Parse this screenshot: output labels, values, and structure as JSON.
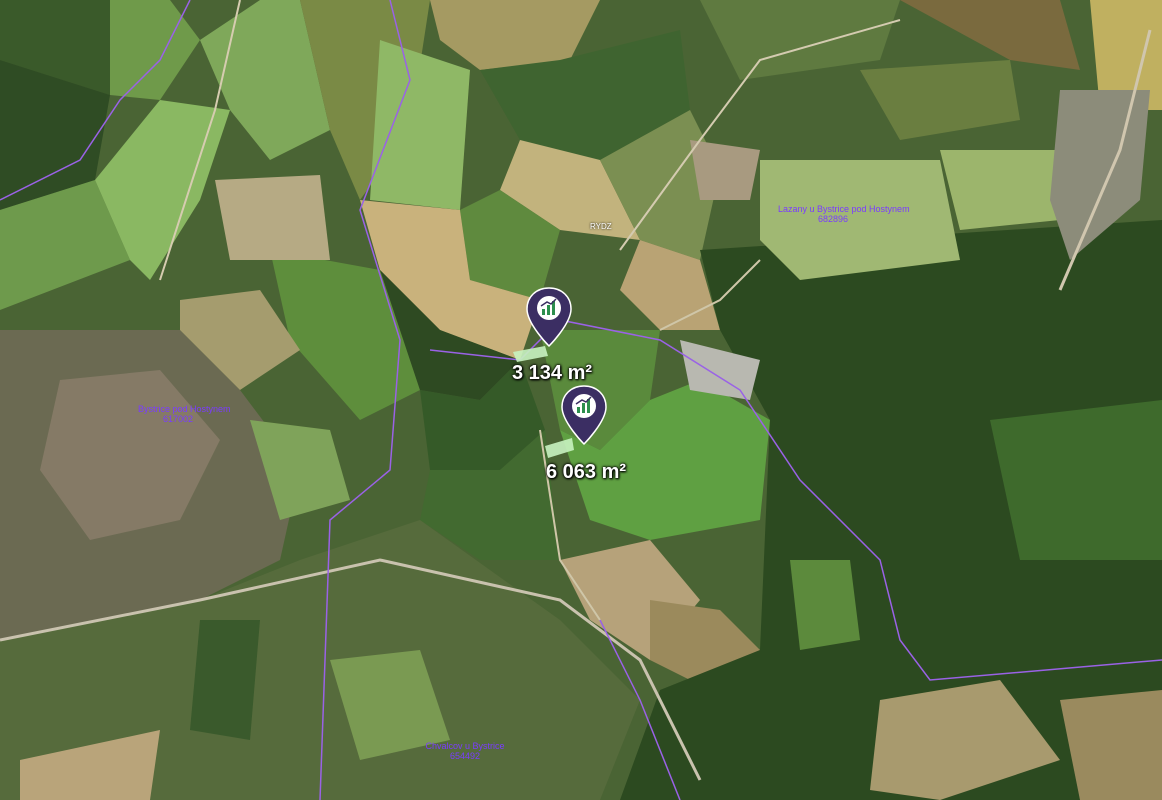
{
  "markers": [
    {
      "area": "3 134 m²",
      "icon": "land-parcel-icon"
    },
    {
      "area": "6 063 m²",
      "icon": "land-parcel-icon"
    }
  ],
  "cadastral_labels": {
    "north_east": {
      "line1": "Lazany u Bystrice pod Hostynem",
      "line2": "682896"
    },
    "west": {
      "line1": "Bystrice pod Hostynem",
      "line2": "617002"
    },
    "south": {
      "line1": "Chvalcov u Bystrice",
      "line2": "654492"
    }
  },
  "parcel_sign": "RYDZ",
  "colors": {
    "marker_fill": "#3b2e63",
    "marker_icon_bg": "#ffffff",
    "marker_icon_accent": "#2d8f4e",
    "boundary": "#9a62e6",
    "parcel_highlight": "#c8f2c0"
  }
}
